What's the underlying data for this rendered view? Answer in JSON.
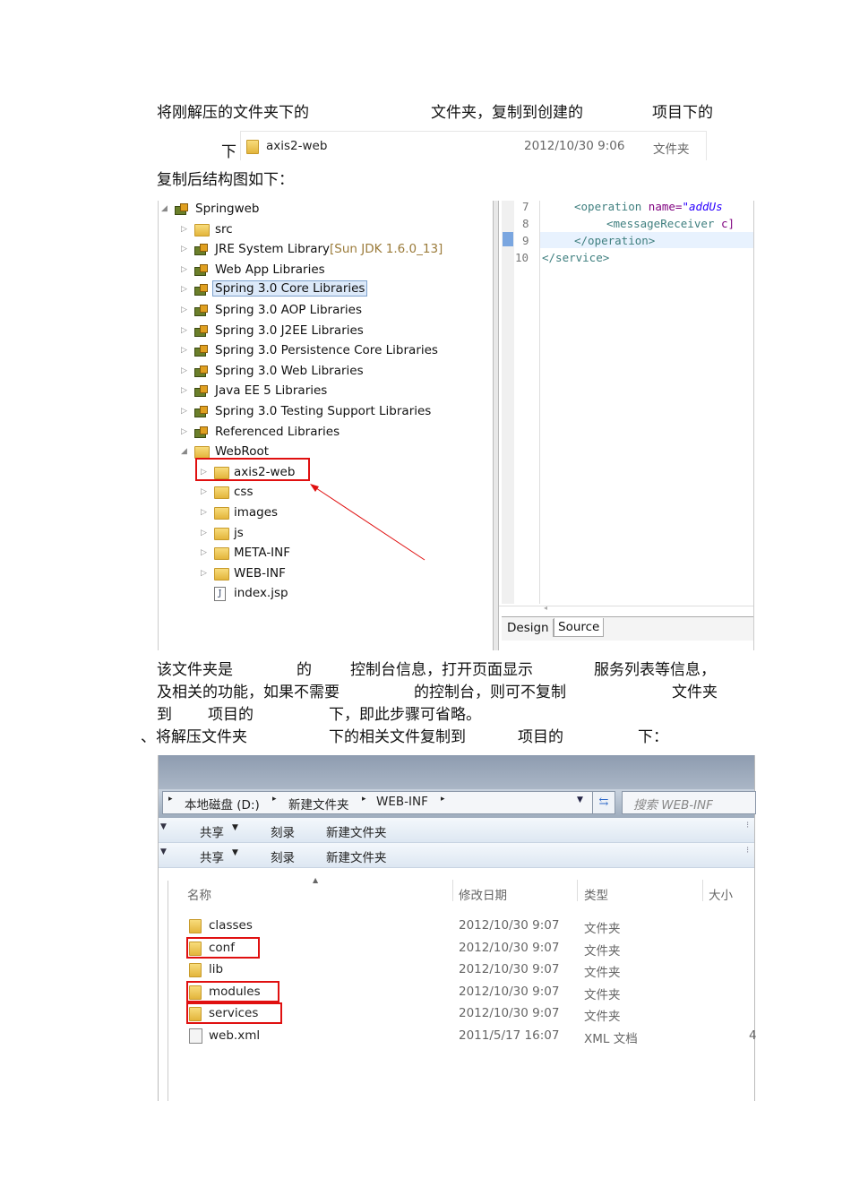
{
  "paragraph1": {
    "line1_a": "将刚解压的文件夹下的",
    "line1_b": "文件夹，复制到创建的",
    "line1_c": "项目下的",
    "line2": "下"
  },
  "folder_entry": {
    "name": "axis2-web",
    "date": "2012/10/30 9:06",
    "type": "文件夹"
  },
  "caption": "复制后结构图如下：",
  "tree": {
    "root": "Springweb",
    "level1": [
      {
        "label": "src",
        "icon": "package-folder-icon"
      },
      {
        "label": "JRE System Library",
        "suffix": "[Sun JDK 1.6.0_13]",
        "icon": "library-icon"
      },
      {
        "label": "Web App Libraries",
        "icon": "library-icon"
      },
      {
        "label": "Spring 3.0 Core Libraries",
        "icon": "library-icon",
        "selected": true
      },
      {
        "label": "Spring 3.0 AOP Libraries",
        "icon": "library-icon"
      },
      {
        "label": "Spring 3.0 J2EE Libraries",
        "icon": "library-icon"
      },
      {
        "label": "Spring 3.0 Persistence Core Libraries",
        "icon": "library-icon"
      },
      {
        "label": "Spring 3.0 Web Libraries",
        "icon": "library-icon"
      },
      {
        "label": "Java EE 5 Libraries",
        "icon": "library-icon"
      },
      {
        "label": "Spring 3.0 Testing Support Libraries",
        "icon": "library-icon"
      },
      {
        "label": "Referenced Libraries",
        "icon": "library-icon"
      },
      {
        "label": "WebRoot",
        "icon": "folder-icon"
      }
    ],
    "level2": [
      {
        "label": "axis2-web",
        "highlight": true
      },
      {
        "label": "css"
      },
      {
        "label": "images"
      },
      {
        "label": "js"
      },
      {
        "label": "META-INF"
      },
      {
        "label": "WEB-INF"
      },
      {
        "label": "index.jsp",
        "icon": "jsp-file-icon"
      }
    ]
  },
  "editor": {
    "lines": [
      {
        "num": "7",
        "tag": "<operation ",
        "attr": "name=",
        "val": "\"addUs"
      },
      {
        "num": "8",
        "tag": "<messageReceiver ",
        "attr": "c]",
        "val": ""
      },
      {
        "num": "9",
        "tag": "</operation>",
        "attr": "",
        "val": ""
      },
      {
        "num": "10",
        "tag": "</service>",
        "attr": "",
        "val": ""
      }
    ],
    "tabs": [
      "Design",
      "Source"
    ]
  },
  "paragraph2": {
    "l1a": "该文件夹是",
    "l1b": "的",
    "l1c": "控制台信息，打开页面显示",
    "l1d": "服务列表等信息，",
    "l2a": "及相关的功能，如果不需要",
    "l2b": "的控制台，则可不复制",
    "l2c": "文件夹",
    "l3a": "到",
    "l3b": "项目的",
    "l3c": "下，即此步骤可省略。",
    "l4a": "、将解压文件夹",
    "l4b": "下的相关文件复制到",
    "l4c": "项目的",
    "l4d": "下："
  },
  "explorer": {
    "breadcrumb": [
      "本地磁盘 (D:)",
      "新建文件夹",
      "WEB-INF"
    ],
    "search_placeholder": "搜索 WEB-INF",
    "toolbar": {
      "share": "共享",
      "burn": "刻录",
      "new_folder": "新建文件夹"
    },
    "columns": [
      "名称",
      "修改日期",
      "类型",
      "大小"
    ],
    "files": [
      {
        "name": "classes",
        "date": "2012/10/30 9:07",
        "type": "文件夹",
        "highlight": false
      },
      {
        "name": "conf",
        "date": "2012/10/30 9:07",
        "type": "文件夹",
        "highlight": true
      },
      {
        "name": "lib",
        "date": "2012/10/30 9:07",
        "type": "文件夹",
        "highlight": false
      },
      {
        "name": "modules",
        "date": "2012/10/30 9:07",
        "type": "文件夹",
        "highlight": true
      },
      {
        "name": "services",
        "date": "2012/10/30 9:07",
        "type": "文件夹",
        "highlight": true
      },
      {
        "name": "web.xml",
        "date": "2011/5/17 16:07",
        "type": "XML 文档",
        "highlight": false,
        "size": "4"
      }
    ]
  },
  "colors": {
    "highlight_red": "#e01010",
    "selection": "#dce9f9"
  }
}
